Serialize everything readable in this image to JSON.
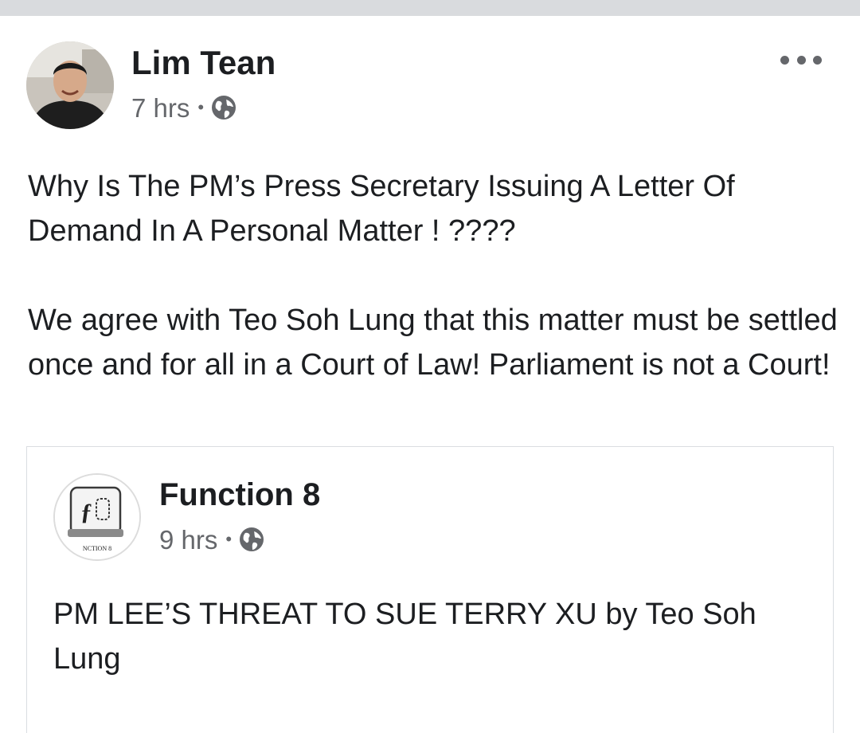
{
  "post": {
    "author": "Lim Tean",
    "time": "7 hrs",
    "separator": "•",
    "privacy_icon": "globe-icon",
    "more_icon": "more-options-icon",
    "paragraph_1": "Why Is The PM’s Press Secretary Issuing A Letter Of Demand In A Personal Matter ! ????",
    "paragraph_2": "We agree with Teo Soh Lung that this matter must be settled once and for all in a Court of Law! Parliament is not a Court!"
  },
  "shared_post": {
    "author": "Function 8",
    "time": "9 hrs",
    "separator": "•",
    "privacy_icon": "globe-icon",
    "logo_text": "NCTION 8",
    "text": "PM LEE’S THREAT TO SUE TERRY XU by Teo Soh Lung"
  },
  "colors": {
    "text_primary": "#1c1e21",
    "text_secondary": "#65676b",
    "border": "#dadde1",
    "top_strip": "#d9dbde"
  }
}
